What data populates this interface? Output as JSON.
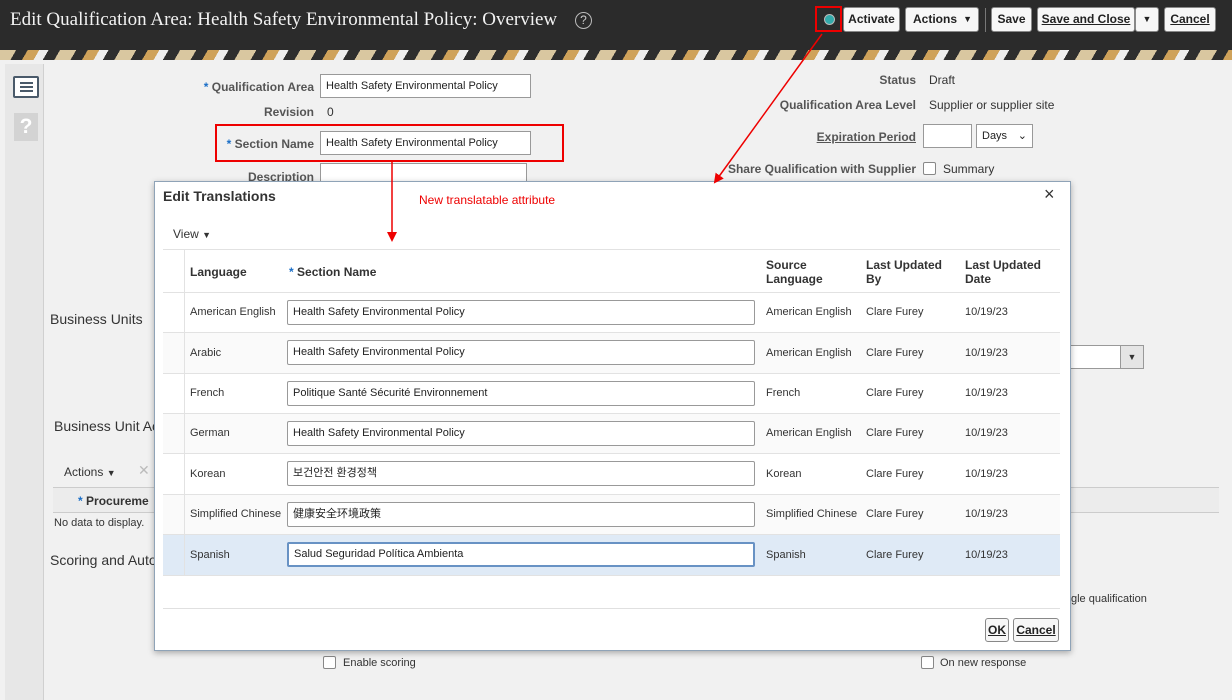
{
  "header": {
    "title": "Edit Qualification Area: Health Safety Environmental Policy: Overview",
    "help_icon_text": "?",
    "buttons": {
      "activate": "Activate",
      "actions": "Actions",
      "save": "Save",
      "save_and_close": "Save and Close",
      "cancel": "Cancel"
    },
    "icons": {
      "translation": "globe-icon",
      "dropdown": "caret-down-icon"
    }
  },
  "form": {
    "qualification_area_label": "Qualification Area",
    "qualification_area_value": "Health Safety Environmental Policy",
    "revision_label": "Revision",
    "revision_value": "0",
    "section_name_label": "Section Name",
    "section_name_value": "Health Safety Environmental Policy",
    "description_label": "Description",
    "status_label": "Status",
    "status_value": "Draft",
    "level_label": "Qualification Area Level",
    "level_value": "Supplier or supplier site",
    "expiration_label": "Expiration Period",
    "expiration_unit": "Days",
    "share_label": "Share Qualification with Supplier",
    "share_option": "Summary",
    "required_marker": "*"
  },
  "background": {
    "business_units_title": "Business Units",
    "business_unit_access_title": "Business Unit Ac",
    "actions_label": "Actions",
    "procurement_col": "Procureme",
    "no_data": "No data to display.",
    "scoring_title": "Scoring and Auto",
    "enable_scoring": "Enable scoring",
    "on_new_response": "On new response",
    "single_qualification": "gle qualification"
  },
  "modal": {
    "title": "Edit Translations",
    "view_menu": "View",
    "columns": {
      "language": "Language",
      "section_name": "Section Name",
      "source_language": "Source Language",
      "last_updated_by": "Last Updated By",
      "last_updated_date": "Last Updated Date"
    },
    "rows": [
      {
        "language": "American English",
        "section_name": "Health Safety Environmental Policy",
        "source_language": "American English",
        "updated_by": "Clare Furey",
        "updated_date": "10/19/23"
      },
      {
        "language": "Arabic",
        "section_name": "Health Safety Environmental Policy",
        "source_language": "American English",
        "updated_by": "Clare Furey",
        "updated_date": "10/19/23"
      },
      {
        "language": "French",
        "section_name": "Politique Santé Sécurité Environnement",
        "source_language": "French",
        "updated_by": "Clare Furey",
        "updated_date": "10/19/23"
      },
      {
        "language": "German",
        "section_name": "Health Safety Environmental Policy",
        "source_language": "American English",
        "updated_by": "Clare Furey",
        "updated_date": "10/19/23"
      },
      {
        "language": "Korean",
        "section_name": "보건안전 환경정책",
        "source_language": "Korean",
        "updated_by": "Clare Furey",
        "updated_date": "10/19/23"
      },
      {
        "language": "Simplified Chinese",
        "section_name": "健康安全环境政策",
        "source_language": "Simplified Chinese",
        "updated_by": "Clare Furey",
        "updated_date": "10/19/23"
      },
      {
        "language": "Spanish",
        "section_name": "Salud Seguridad Política Ambienta",
        "source_language": "Spanish",
        "updated_by": "Clare Furey",
        "updated_date": "10/19/23"
      }
    ],
    "ok_button": "OK",
    "cancel_button": "Cancel",
    "close_icon": "×"
  },
  "annotation": {
    "text": "New translatable attribute",
    "color": "#ee0000"
  }
}
